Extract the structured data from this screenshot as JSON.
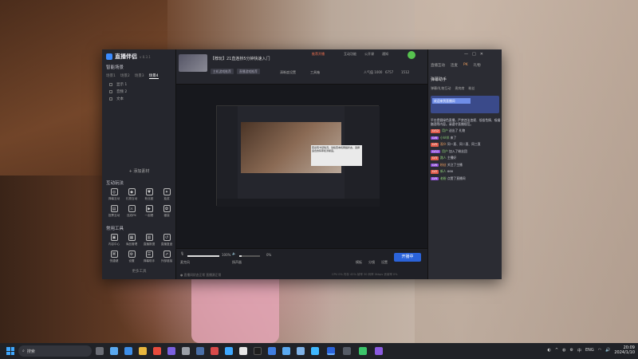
{
  "app": {
    "name": "直播伴侣",
    "version": "v 8.3.1",
    "stream_title": "【荐玩】21直连桥5分钟快速入门",
    "stream_tag": "",
    "tags": [
      "主机游戏推荐",
      "直播游戏推荐"
    ],
    "header_actions": [
      "推荐开播",
      "开播须知",
      "人数"
    ],
    "header_right_actions": [
      "互动功能",
      "公开课",
      "通知"
    ],
    "header_bottom": [
      "清晰度设置",
      "工具箱"
    ],
    "counters": [
      "6757",
      "1512",
      "人气值 1000"
    ],
    "scene": {
      "title": "智能场景",
      "tabs": [
        "场景1",
        "场景2",
        "场景3",
        "场景4"
      ],
      "add_source": "+ 添加素材",
      "sources": [
        "显示 1",
        "音频 2",
        "文本"
      ]
    },
    "interact_title": "互动玩法",
    "interact_items": [
      "弹幕互动",
      "礼物互动",
      "粉丝团",
      "抽奖",
      "投票互动",
      "连线PK",
      "一起看",
      "福袋"
    ],
    "tools_title": "常用工具",
    "tools_items": [
      "内容中心",
      "商品管理",
      "直播数据",
      "直播复盘",
      "快捷键",
      "设置",
      "弹幕助手",
      "外部链接"
    ],
    "more_tools": "更多工具",
    "bottom": {
      "mic_label": "麦克风",
      "mic_value": "100%",
      "speaker_label": "扬声器",
      "speaker_value": "0%",
      "mic_level": 1.0,
      "speaker_level": 0.1,
      "icons": [
        "模板",
        "分镜",
        "设置"
      ],
      "start_button": "开播中",
      "status": "● 直播间状态正常 直播源正常",
      "stats": "CPU 0%  内存 42%  帧率 30  码率 0kbps  丢帧率 0%"
    },
    "preview_tooltip": "若出现卡顿情况，请检查本机网络状态，选择适合的码率和清晰度。"
  },
  "chat": {
    "tabs": [
      "直播互动",
      "连麦",
      "PK",
      "礼物"
    ],
    "title": "弹幕助手",
    "sub_tabs": [
      "弹幕/礼物互动",
      "贵宾席",
      "粉丝"
    ],
    "banner": "欢迎来到直播间",
    "messages": [
      {
        "badge": "",
        "nick": "",
        "text": "平台提倡绿色直播，严禁违法违规、低俗色情、吸烟酗酒等内容。请遵守直播规范。"
      },
      {
        "badge": "LV12",
        "nick": "用户",
        "text": "送出了 礼物"
      },
      {
        "badge": "LV8",
        "nick": "小伙伴",
        "text": "来了"
      },
      {
        "badge": "LV5",
        "nick": "观众",
        "text": "同一直、同二直、同三直"
      },
      {
        "badge": "LV12",
        "nick": "用户",
        "text": "加入了粉丝团"
      },
      {
        "badge": "LV3",
        "nick": "路人",
        "text": "主播好"
      },
      {
        "badge": "LV6",
        "nick": "粉丝",
        "text": "关注了主播"
      },
      {
        "badge": "LV2",
        "nick": "新人",
        "text": "666"
      },
      {
        "badge": "LV9",
        "nick": "老粉",
        "text": "点赞了直播间"
      }
    ]
  },
  "taskbar": {
    "search_placeholder": "搜索",
    "lang": "ENG",
    "time": "20:09",
    "date": "2024/1/10"
  },
  "colors": {
    "accent": "#2b63d9",
    "live_green": "#57c24f",
    "chat_orange": "#f0a060",
    "badge_purple": "#8f4fd8",
    "badge_red": "#e05b4b"
  }
}
